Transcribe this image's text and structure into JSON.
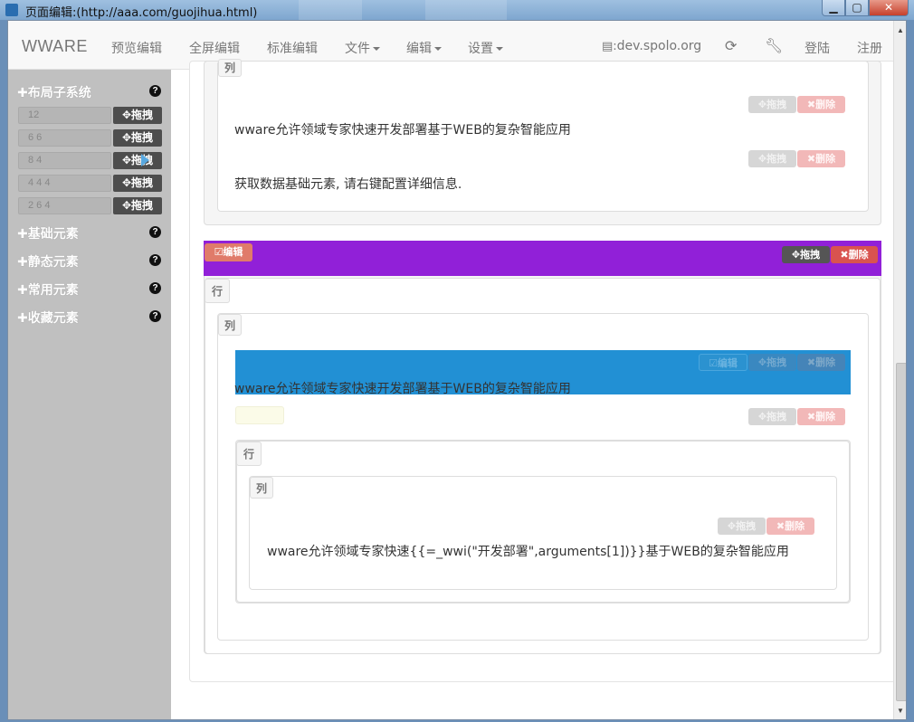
{
  "window": {
    "title": "页面编辑:(http://aaa.com/guojihua.html)",
    "buttons": {
      "minimize": "▁",
      "maximize": "▢",
      "close": "✕"
    }
  },
  "navbar": {
    "brand": "WWARE",
    "items": [
      "预览编辑",
      "全屏编辑",
      "标准编辑",
      "文件",
      "编辑",
      "设置"
    ],
    "domain": "dev.spolo.org",
    "login": "登陆",
    "register": "注册"
  },
  "sidebar": {
    "layout_title": "布局子系统",
    "grid_rows": [
      {
        "value": "12",
        "drag": "✥拖拽"
      },
      {
        "value": "6 6",
        "drag": "✥拖拽"
      },
      {
        "value": "8 4",
        "drag": "✥拖拽"
      },
      {
        "value": "4 4 4",
        "drag": "✥拖拽"
      },
      {
        "value": "2 6 4",
        "drag": "✥拖拽"
      }
    ],
    "sections": [
      "基础元素",
      "静态元素",
      "常用元素",
      "收藏元素"
    ],
    "help": "?"
  },
  "main": {
    "top_block": {
      "text1": "wware允许领域专家快速开发部署基于WEB的复杂智能应用",
      "text2": "获取数据基础元素, 请右键配置详细信息."
    },
    "buttons": {
      "edit": "☑编辑",
      "drag": "✥拖拽",
      "delete": "✖删除"
    },
    "row_label": "行",
    "col_label": "列",
    "selected_text": "wware允许领域专家快速开发部署基于WEB的复杂智能应用",
    "nested_text": "wware允许领域专家快速{{=_wwi(\"开发部署\",arguments[1])}}基于WEB的复杂智能应用"
  },
  "colors": {
    "purple_bar": "#9120d8",
    "selected_blue": "#2290d4",
    "sidebar_bg": "#c0c0c0"
  }
}
